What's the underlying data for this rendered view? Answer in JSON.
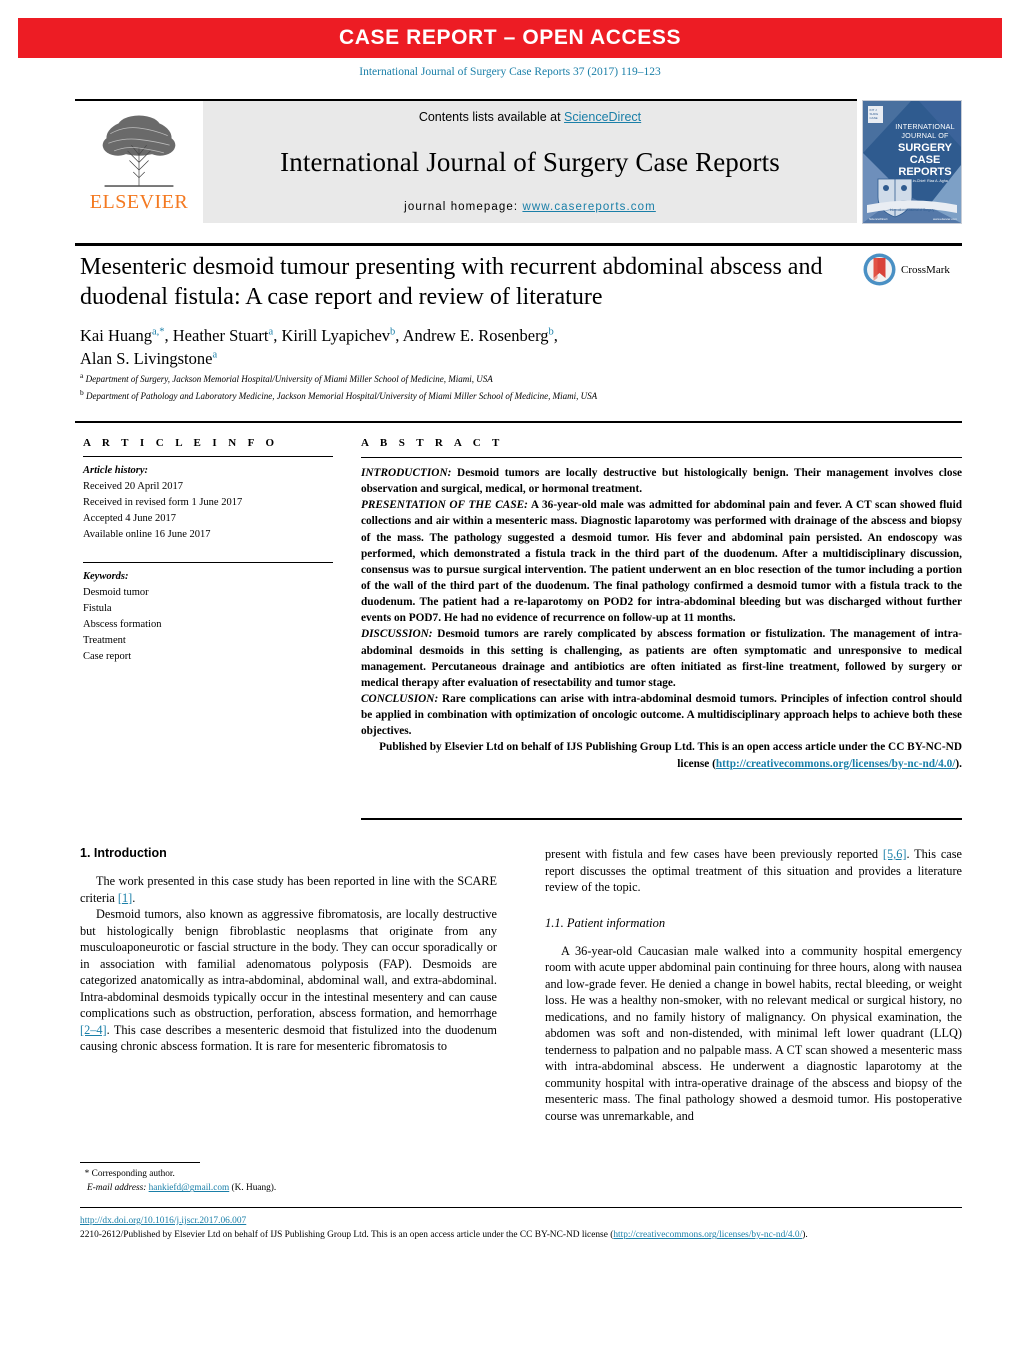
{
  "banner": {
    "text": "CASE REPORT – OPEN ACCESS",
    "color": "#ed1c24"
  },
  "citation": "International Journal of Surgery Case Reports 37 (2017) 119–123",
  "journal_header": {
    "contents_prefix": "Contents lists available at ",
    "contents_link": "ScienceDirect",
    "journal_name": "International Journal of Surgery Case Reports",
    "homepage_prefix": "journal homepage: ",
    "homepage_link": "www.casereports.com",
    "publisher": "ELSEVIER",
    "cover_lines": [
      "INTERNATIONAL",
      "JOURNAL OF",
      "SURGERY",
      "CASE",
      "REPORTS"
    ]
  },
  "crossmark": {
    "label": "CrossMark"
  },
  "article": {
    "title": "Mesenteric desmoid tumour presenting with recurrent abdominal abscess and duodenal fistula: A case report and review of literature",
    "authors_line1_a": "Kai Huang",
    "authors_sup1": "a,*",
    "authors_line1_b": ", Heather Stuart",
    "authors_sup2": "a",
    "authors_line1_c": ", Kirill Lyapichev",
    "authors_sup3": "b",
    "authors_line1_d": ", Andrew E. Rosenberg",
    "authors_sup4": "b",
    "authors_line1_e": ",",
    "authors_line2": "Alan S. Livingstone",
    "authors_sup5": "a",
    "affiliation_a_sup": "a",
    "affiliation_a": "Department of Surgery, Jackson Memorial Hospital/University of Miami Miller School of Medicine, Miami, USA",
    "affiliation_b_sup": "b",
    "affiliation_b": "Department of Pathology and Laboratory Medicine, Jackson Memorial Hospital/University of Miami Miller School of Medicine, Miami, USA"
  },
  "article_info": {
    "heading": "A R T I C L E   I N F O",
    "history_label": "Article history:",
    "history": [
      "Received 20 April 2017",
      "Received in revised form 1 June 2017",
      "Accepted 4 June 2017",
      "Available online 16 June 2017"
    ],
    "keywords_label": "Keywords:",
    "keywords": [
      "Desmoid tumor",
      "Fistula",
      "Abscess formation",
      "Treatment",
      "Case report"
    ]
  },
  "abstract": {
    "heading": "A B S T R A C T",
    "sections": [
      {
        "label": "INTRODUCTION:",
        "text": " Desmoid tumors are locally destructive but histologically benign. Their management involves close observation and surgical, medical, or hormonal treatment."
      },
      {
        "label": "PRESENTATION OF THE CASE:",
        "text": " A 36-year-old male was admitted for abdominal pain and fever. A CT scan showed fluid collections and air within a mesenteric mass. Diagnostic laparotomy was performed with drainage of the abscess and biopsy of the mass. The pathology suggested a desmoid tumor. His fever and abdominal pain persisted. An endoscopy was performed, which demonstrated a fistula track in the third part of the duodenum. After a multidisciplinary discussion, consensus was to pursue surgical intervention. The patient underwent an en bloc resection of the tumor including a portion of the wall of the third part of the duodenum. The final pathology confirmed a desmoid tumor with a fistula track to the duodenum. The patient had a re-laparotomy on POD2 for intra-abdominal bleeding but was discharged without further events on POD7. He had no evidence of recurrence on follow-up at 11 months."
      },
      {
        "label": "DISCUSSION:",
        "text": " Desmoid tumors are rarely complicated by abscess formation or fistulization. The management of intra-abdominal desmoids in this setting is challenging, as patients are often symptomatic and unresponsive to medical management. Percutaneous drainage and antibiotics are often initiated as first-line treatment, followed by surgery or medical therapy after evaluation of resectability and tumor stage."
      },
      {
        "label": "CONCLUSION:",
        "text": " Rare complications can arise with intra-abdominal desmoid tumors. Principles of infection control should be applied in combination with optimization of oncologic outcome. A multidisciplinary approach helps to achieve both these objectives."
      }
    ],
    "license_text": "Published by Elsevier Ltd on behalf of IJS Publishing Group Ltd. This is an open access article under the CC BY-NC-ND license (",
    "license_link": "http://creativecommons.org/licenses/by-nc-nd/4.0/",
    "license_tail": ")."
  },
  "body": {
    "left": {
      "section_heading": "1.  Introduction",
      "para1_pre": "The work presented in this case study has been reported in line with the SCARE criteria ",
      "para1_ref": "[1]",
      "para1_post": ".",
      "para2_pre": "Desmoid tumors, also known as aggressive fibromatosis, are locally destructive but histologically benign fibroblastic neoplasms that originate from any musculoaponeurotic or fascial structure in the body. They can occur sporadically or in association with familial adenomatous polyposis (FAP). Desmoids are categorized anatomically as intra-abdominal, abdominal wall, and extra-abdominal. Intra-abdominal desmoids typically occur in the intestinal mesentery and can cause complications such as obstruction, perforation, abscess formation, and hemorrhage ",
      "para2_ref": "[2–4]",
      "para2_post": ". This case describes a mesenteric desmoid that fistulized into the duodenum causing chronic abscess formation. It is rare for mesenteric fibromatosis to"
    },
    "right": {
      "para1_pre": "present with fistula and few cases have been previously reported ",
      "para1_ref": "[5,6]",
      "para1_post": ". This case report discusses the optimal treatment of this situation and provides a literature review of the topic.",
      "subsection_heading": "1.1.  Patient information",
      "para2": "A 36-year-old Caucasian male walked into a community hospital emergency room with acute upper abdominal pain continuing for three hours, along with nausea and low-grade fever. He denied a change in bowel habits, rectal bleeding, or weight loss. He was a healthy non-smoker, with no relevant medical or surgical history, no medications, and no family history of malignancy. On physical examination, the abdomen was soft and non-distended, with minimal left lower quadrant (LLQ) tenderness to palpation and no palpable mass. A CT scan showed a mesenteric mass with intra-abdominal abscess. He underwent a diagnostic laparotomy at the community hospital with intra-operative drainage of the abscess and biopsy of the mesenteric mass. The final pathology showed a desmoid tumor. His postoperative course was unremarkable, and"
    }
  },
  "footnote": {
    "star": "*",
    "corresponding": "Corresponding author.",
    "email_label": "E-mail address:",
    "email": "hankiefd@gmail.com",
    "email_owner": "(K. Huang)."
  },
  "footer": {
    "doi": "http://dx.doi.org/10.1016/j.ijscr.2017.06.007",
    "line_pre": "2210-2612/Published by Elsevier Ltd on behalf of IJS Publishing Group Ltd. This is an open access article under the CC BY-NC-ND license (",
    "line_link": "http://creativecommons.org/licenses/by-nc-nd/4.0/",
    "line_post": ")."
  }
}
